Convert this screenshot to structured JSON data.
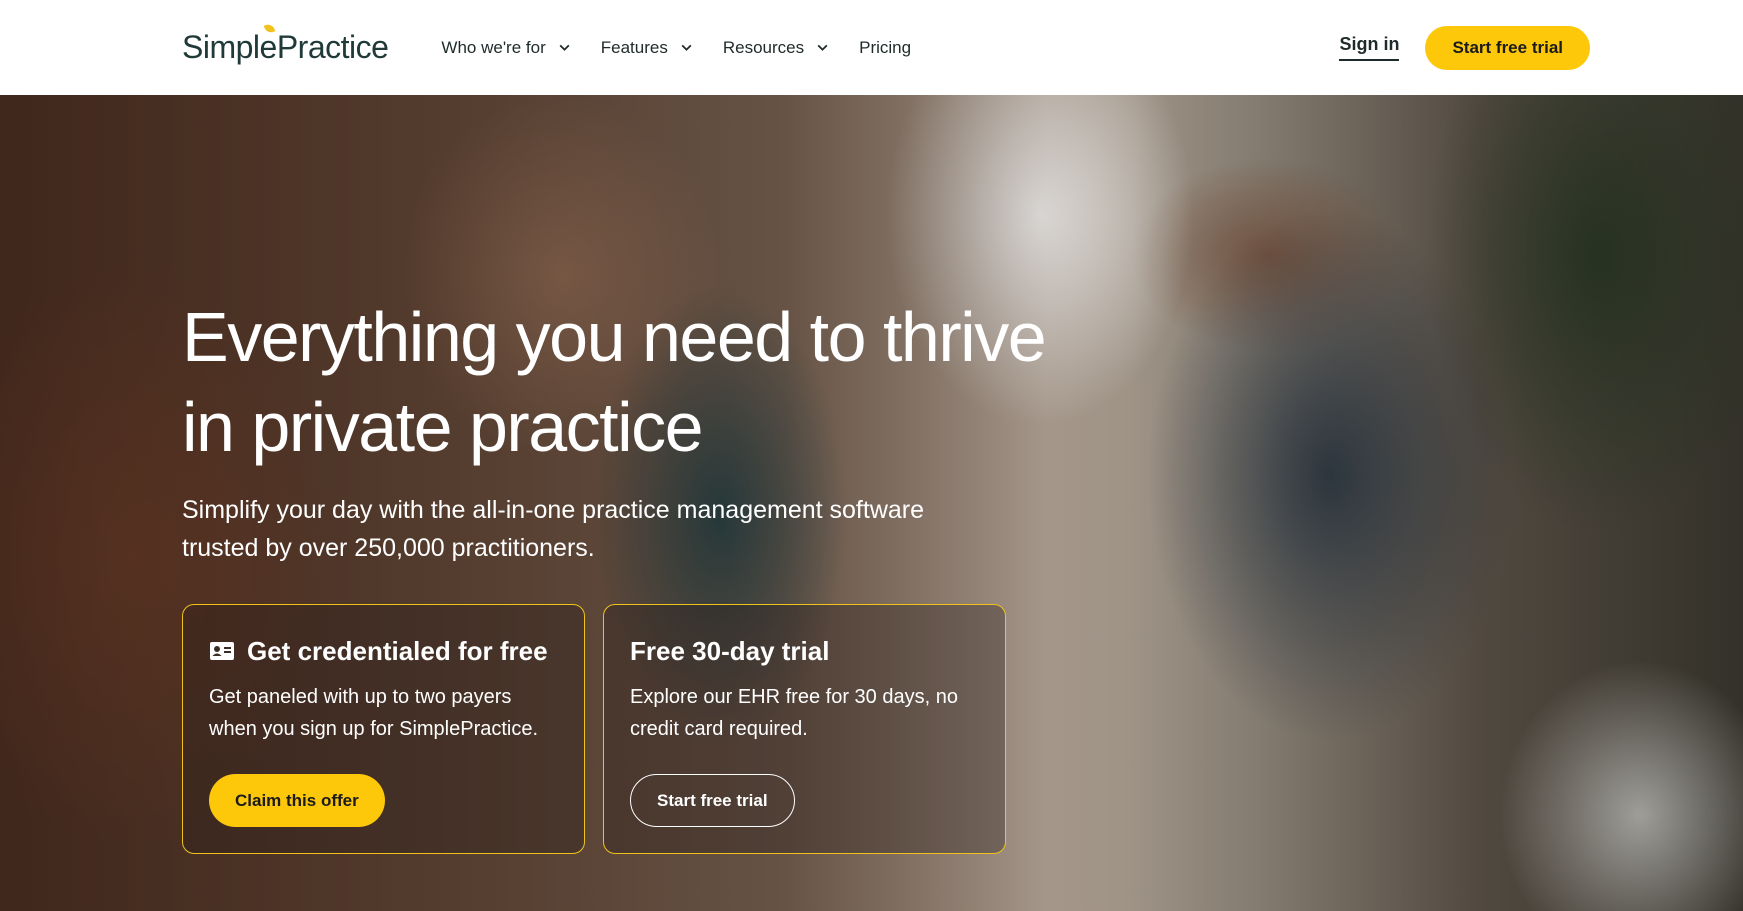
{
  "header": {
    "logo": "SimplePractice",
    "nav": [
      {
        "label": "Who we're for",
        "has_dropdown": true
      },
      {
        "label": "Features",
        "has_dropdown": true
      },
      {
        "label": "Resources",
        "has_dropdown": true
      },
      {
        "label": "Pricing",
        "has_dropdown": false
      }
    ],
    "sign_in": "Sign in",
    "cta": "Start free trial"
  },
  "hero": {
    "title": "Everything you need to thrive in private practice",
    "subtitle": "Simplify your day with the all-in-one practice management software trusted by over 250,000 practitioners.",
    "cards": [
      {
        "icon": "id-card-icon",
        "title": "Get credentialed for free",
        "text": "Get paneled with up to two payers when you sign up for SimplePractice.",
        "button": "Claim this offer"
      },
      {
        "title": "Free 30-day trial",
        "text": "Explore our EHR free for 30 days, no credit card required.",
        "button": "Start free trial"
      }
    ]
  },
  "colors": {
    "accent": "#fdc70a",
    "brand_text": "#1f3a38",
    "card_border": "#f0c21c"
  }
}
